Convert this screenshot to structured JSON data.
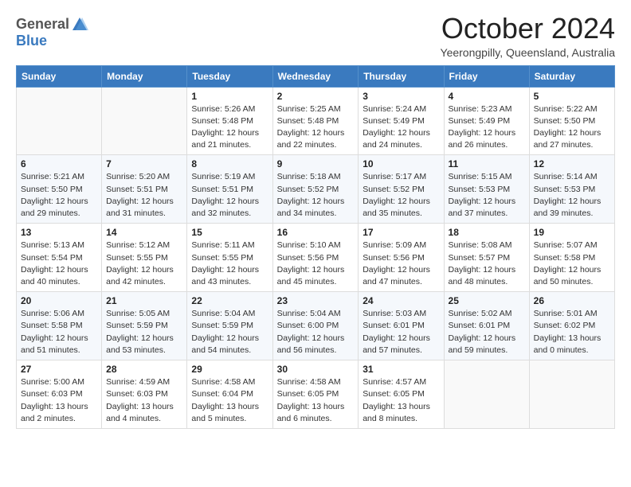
{
  "logo": {
    "general": "General",
    "blue": "Blue"
  },
  "header": {
    "month": "October 2024",
    "subtitle": "Yeerongpilly, Queensland, Australia"
  },
  "weekdays": [
    "Sunday",
    "Monday",
    "Tuesday",
    "Wednesday",
    "Thursday",
    "Friday",
    "Saturday"
  ],
  "weeks": [
    [
      {
        "day": "",
        "info": ""
      },
      {
        "day": "",
        "info": ""
      },
      {
        "day": "1",
        "info": "Sunrise: 5:26 AM\nSunset: 5:48 PM\nDaylight: 12 hours and 21 minutes."
      },
      {
        "day": "2",
        "info": "Sunrise: 5:25 AM\nSunset: 5:48 PM\nDaylight: 12 hours and 22 minutes."
      },
      {
        "day": "3",
        "info": "Sunrise: 5:24 AM\nSunset: 5:49 PM\nDaylight: 12 hours and 24 minutes."
      },
      {
        "day": "4",
        "info": "Sunrise: 5:23 AM\nSunset: 5:49 PM\nDaylight: 12 hours and 26 minutes."
      },
      {
        "day": "5",
        "info": "Sunrise: 5:22 AM\nSunset: 5:50 PM\nDaylight: 12 hours and 27 minutes."
      }
    ],
    [
      {
        "day": "6",
        "info": "Sunrise: 5:21 AM\nSunset: 5:50 PM\nDaylight: 12 hours and 29 minutes."
      },
      {
        "day": "7",
        "info": "Sunrise: 5:20 AM\nSunset: 5:51 PM\nDaylight: 12 hours and 31 minutes."
      },
      {
        "day": "8",
        "info": "Sunrise: 5:19 AM\nSunset: 5:51 PM\nDaylight: 12 hours and 32 minutes."
      },
      {
        "day": "9",
        "info": "Sunrise: 5:18 AM\nSunset: 5:52 PM\nDaylight: 12 hours and 34 minutes."
      },
      {
        "day": "10",
        "info": "Sunrise: 5:17 AM\nSunset: 5:52 PM\nDaylight: 12 hours and 35 minutes."
      },
      {
        "day": "11",
        "info": "Sunrise: 5:15 AM\nSunset: 5:53 PM\nDaylight: 12 hours and 37 minutes."
      },
      {
        "day": "12",
        "info": "Sunrise: 5:14 AM\nSunset: 5:53 PM\nDaylight: 12 hours and 39 minutes."
      }
    ],
    [
      {
        "day": "13",
        "info": "Sunrise: 5:13 AM\nSunset: 5:54 PM\nDaylight: 12 hours and 40 minutes."
      },
      {
        "day": "14",
        "info": "Sunrise: 5:12 AM\nSunset: 5:55 PM\nDaylight: 12 hours and 42 minutes."
      },
      {
        "day": "15",
        "info": "Sunrise: 5:11 AM\nSunset: 5:55 PM\nDaylight: 12 hours and 43 minutes."
      },
      {
        "day": "16",
        "info": "Sunrise: 5:10 AM\nSunset: 5:56 PM\nDaylight: 12 hours and 45 minutes."
      },
      {
        "day": "17",
        "info": "Sunrise: 5:09 AM\nSunset: 5:56 PM\nDaylight: 12 hours and 47 minutes."
      },
      {
        "day": "18",
        "info": "Sunrise: 5:08 AM\nSunset: 5:57 PM\nDaylight: 12 hours and 48 minutes."
      },
      {
        "day": "19",
        "info": "Sunrise: 5:07 AM\nSunset: 5:58 PM\nDaylight: 12 hours and 50 minutes."
      }
    ],
    [
      {
        "day": "20",
        "info": "Sunrise: 5:06 AM\nSunset: 5:58 PM\nDaylight: 12 hours and 51 minutes."
      },
      {
        "day": "21",
        "info": "Sunrise: 5:05 AM\nSunset: 5:59 PM\nDaylight: 12 hours and 53 minutes."
      },
      {
        "day": "22",
        "info": "Sunrise: 5:04 AM\nSunset: 5:59 PM\nDaylight: 12 hours and 54 minutes."
      },
      {
        "day": "23",
        "info": "Sunrise: 5:04 AM\nSunset: 6:00 PM\nDaylight: 12 hours and 56 minutes."
      },
      {
        "day": "24",
        "info": "Sunrise: 5:03 AM\nSunset: 6:01 PM\nDaylight: 12 hours and 57 minutes."
      },
      {
        "day": "25",
        "info": "Sunrise: 5:02 AM\nSunset: 6:01 PM\nDaylight: 12 hours and 59 minutes."
      },
      {
        "day": "26",
        "info": "Sunrise: 5:01 AM\nSunset: 6:02 PM\nDaylight: 13 hours and 0 minutes."
      }
    ],
    [
      {
        "day": "27",
        "info": "Sunrise: 5:00 AM\nSunset: 6:03 PM\nDaylight: 13 hours and 2 minutes."
      },
      {
        "day": "28",
        "info": "Sunrise: 4:59 AM\nSunset: 6:03 PM\nDaylight: 13 hours and 4 minutes."
      },
      {
        "day": "29",
        "info": "Sunrise: 4:58 AM\nSunset: 6:04 PM\nDaylight: 13 hours and 5 minutes."
      },
      {
        "day": "30",
        "info": "Sunrise: 4:58 AM\nSunset: 6:05 PM\nDaylight: 13 hours and 6 minutes."
      },
      {
        "day": "31",
        "info": "Sunrise: 4:57 AM\nSunset: 6:05 PM\nDaylight: 13 hours and 8 minutes."
      },
      {
        "day": "",
        "info": ""
      },
      {
        "day": "",
        "info": ""
      }
    ]
  ]
}
